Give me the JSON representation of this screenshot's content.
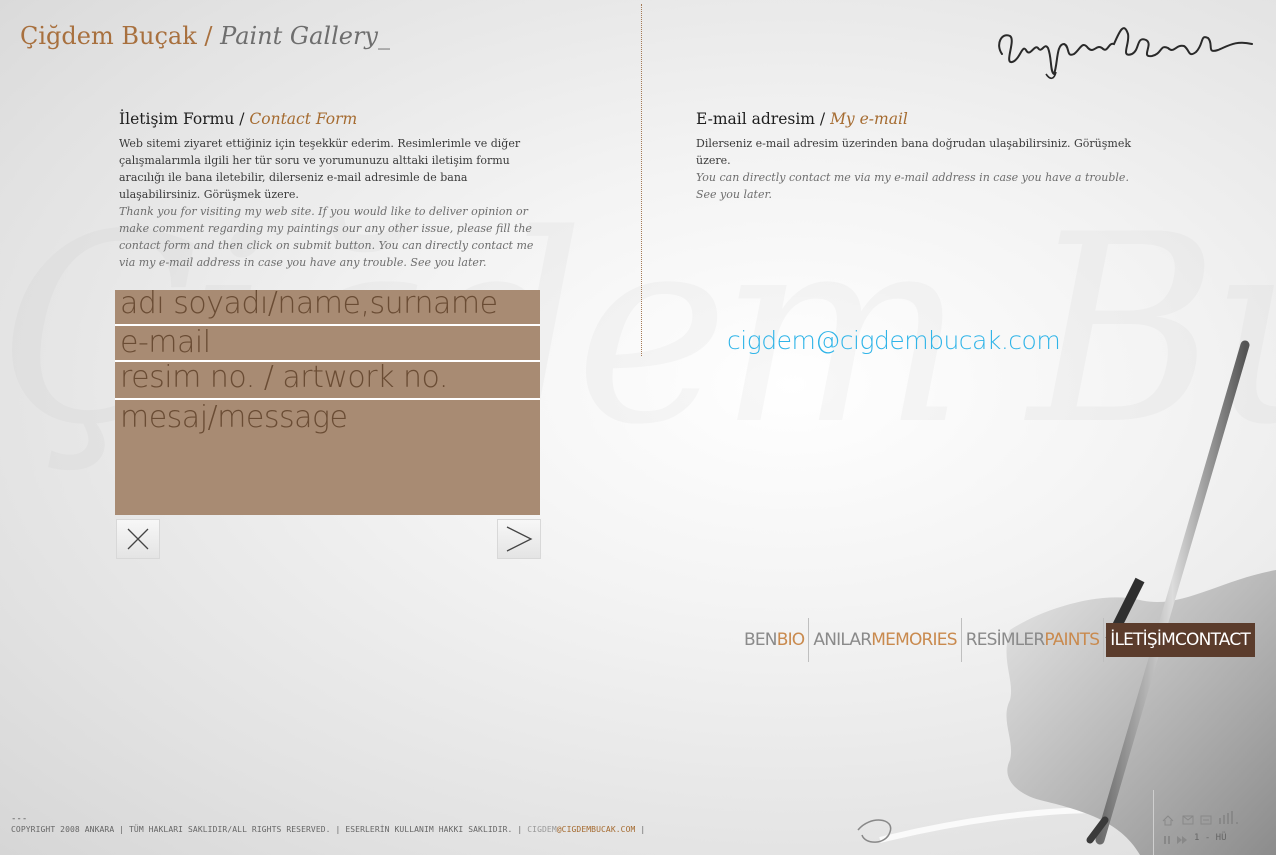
{
  "brand": {
    "name": "Çiğdem Buçak",
    "separator": "/",
    "gallery": "Paint Gallery_"
  },
  "contact_form": {
    "title_tr": "İletişim Formu /",
    "title_en": "Contact Form",
    "text_tr": "Web sitemi ziyaret ettiğiniz için teşekkür ederim. Resimlerimle ve diğer çalışmalarımla ilgili her tür soru ve  yorumunuzu alttaki iletişim formu aracılığı ile bana iletebilir, dilerseniz e-mail adresimle de bana ulaşabilirsiniz. Görüşmek üzere.",
    "text_en": "Thank you for visiting  my web site.  If you would like to deliver opinion or make comment regarding my paintings our any other issue, please fill the contact form and then click on submit button. You can directly contact me via my e-mail address in case you have any trouble. See you later.",
    "fields": {
      "name": "adı soyadı/name,surname",
      "email": "e-mail",
      "artwork": "resim no. / artwork no.",
      "message": "mesaj/message"
    }
  },
  "my_email": {
    "title_tr": "E-mail adresim /",
    "title_en": "My e-mail",
    "text_tr": "Dilerseniz e-mail adresim üzerinden bana doğrudan ulaşabilirsiniz. Görüşmek üzere.",
    "text_en_line1": "You can directly contact me via my e-mail address in case you have a trouble.",
    "text_en_line2": "See you later.",
    "address": "cigdem@cigdembucak.com"
  },
  "nav": [
    {
      "tr": "BEN",
      "en": "BIO"
    },
    {
      "tr": "ANILAR",
      "en": "MEMORIES"
    },
    {
      "tr": "RESİMLER",
      "en": "PAINTS"
    },
    {
      "tr": "İLETİŞİM",
      "en": "CONTACT"
    }
  ],
  "footer": {
    "dash": "---",
    "copyright": "COPYRIGHT 2008 ANKARA  | TÜM HAKLARI SAKLIDIR/ALL RIGHTS RESERVED.  |  ESERLERİN KULLANIM HAKKI SAKLIDIR.  |",
    "mail_prefix": "CIGDEM",
    "mail_rest": "@CIGDEMBUCAK.COM",
    "tail": " |"
  },
  "player": {
    "track": "1 - HÜ"
  },
  "colors": {
    "accent": "#a56b30",
    "field_bg": "#a88b73",
    "active_nav": "#5b3c2c",
    "email": "#2fb4e8"
  }
}
